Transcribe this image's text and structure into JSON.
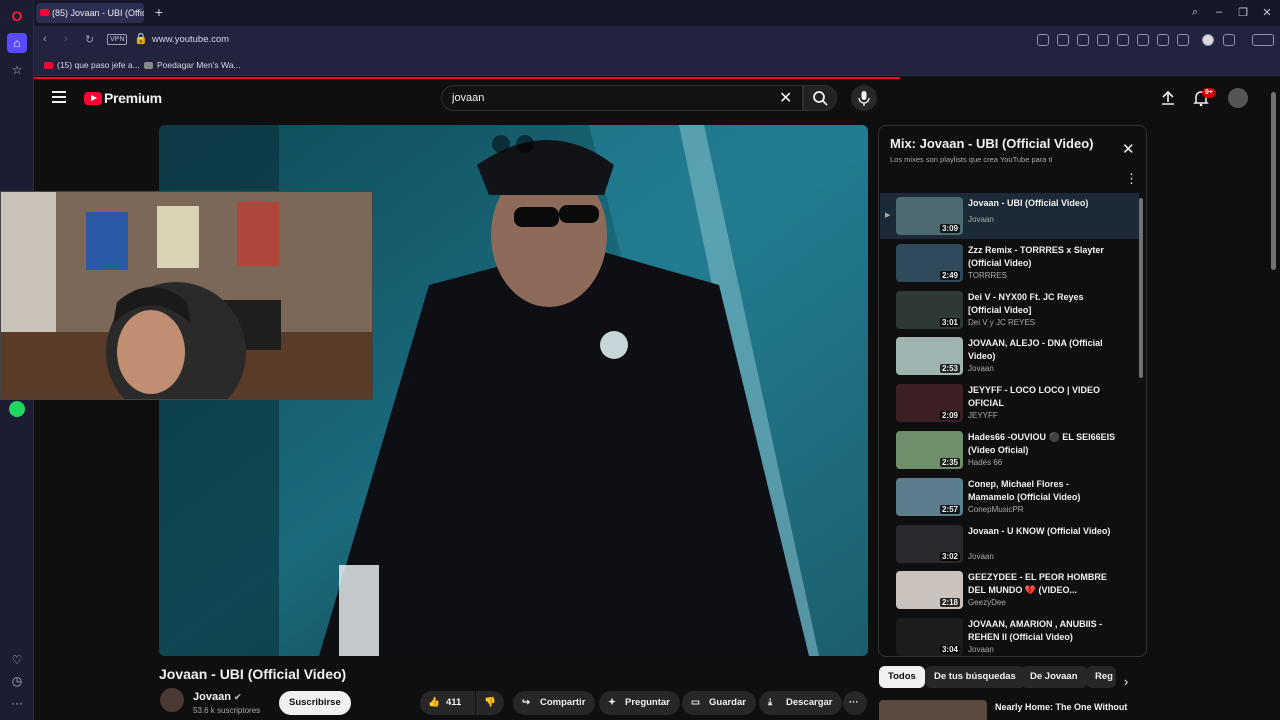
{
  "browser": {
    "tab_title": "(85) Jovaan - UBI (Official",
    "vpn_label": "VPN",
    "url": "www.youtube.com",
    "bookmarks": [
      "(15) que paso jefe a...",
      "Poedagar Men's Wa..."
    ]
  },
  "header": {
    "logo_text": "Premium",
    "search_value": "jovaan",
    "notification_badge": "9+"
  },
  "video": {
    "title": "Jovaan - UBI (Official Video)",
    "channel": "Jovaan",
    "subscribers": "53.6 k suscriptores",
    "subscribe_label": "Suscribirse",
    "likes": "411",
    "share_label": "Compartir",
    "ask_label": "Preguntar",
    "save_label": "Guardar",
    "download_label": "Descargar"
  },
  "playlist": {
    "title": "Mix: Jovaan - UBI (Official Video)",
    "subtitle": "Los mixes son playlists que crea YouTube para ti",
    "items": [
      {
        "title": "Jovaan - UBI (Official Video)",
        "channel": "Jovaan",
        "duration": "3:09",
        "color": "#4d6a73"
      },
      {
        "title": "Zzz Remix - TORRRES x Slayter (Official Video)",
        "channel": "TORRRES",
        "duration": "2:49",
        "color": "#2f4a5a"
      },
      {
        "title": "Dei V - NYX00 Ft. JC Reyes [Official Video]",
        "channel": "Dei V y JC REYES",
        "duration": "3:01",
        "color": "#2e3834"
      },
      {
        "title": "JOVAAN, ALEJO - DNA (Official Video)",
        "channel": "Jovaan",
        "duration": "2:53",
        "color": "#9fb3b0"
      },
      {
        "title": "JEYYFF - LOCO LOCO | VIDEO OFICIAL",
        "channel": "JEYYFF",
        "duration": "2:09",
        "color": "#3b1f22"
      },
      {
        "title": "Hades66 -OUVIOU ⚫ EL SEI66EIS (Video Oficial)",
        "channel": "Hades 66",
        "duration": "2:35",
        "color": "#6f8f6c"
      },
      {
        "title": "Conep, Michael Flores - Mamamelo (Official Video)",
        "channel": "ConepMusicPR",
        "duration": "2:57",
        "color": "#5c7d8c"
      },
      {
        "title": "Jovaan - U KNOW (Official Video)",
        "channel": "Jovaan",
        "duration": "3:02",
        "color": "#2a2a2e"
      },
      {
        "title": "GEEZYDEE - EL PEOR HOMBRE DEL MUNDO 💔 (VIDEO...",
        "channel": "GeezyDee",
        "duration": "2:18",
        "color": "#c9c2bd"
      },
      {
        "title": "JOVAAN, AMARION , ANUBIIS - REHEN II (Official Video)",
        "channel": "Jovaan",
        "duration": "3:04",
        "color": "#1c1c1c"
      }
    ]
  },
  "chips": [
    "Todos",
    "De tus búsquedas",
    "De Jovaan",
    "Reg"
  ],
  "up_next": "Nearly Home: The One Without"
}
